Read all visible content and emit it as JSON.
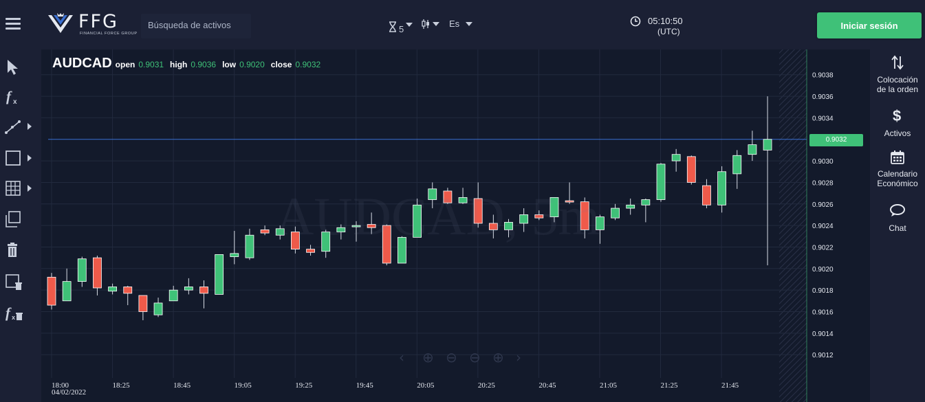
{
  "header": {
    "logo_text": "FFG",
    "logo_subtext": "FINANCIAL FORCE GROUP",
    "search_placeholder": "Búsqueda de activos",
    "timeframe_value": "5",
    "language": "Es",
    "clock_time": "05:10:50",
    "clock_zone": "(UTC)",
    "login_label": "Iniciar sesión",
    "login_color": "#3fc178"
  },
  "left_toolbar": {
    "tools": [
      {
        "name": "cursor-tool",
        "icon": "cursor-icon",
        "has_submenu": false
      },
      {
        "name": "indicator-tool",
        "icon": "function-icon",
        "has_submenu": false
      },
      {
        "name": "trendline-tool",
        "icon": "trendline-icon",
        "has_submenu": true
      },
      {
        "name": "rectangle-tool",
        "icon": "rectangle-icon",
        "has_submenu": true
      },
      {
        "name": "grid-tool",
        "icon": "grid-icon",
        "has_submenu": true
      },
      {
        "name": "clone-tool",
        "icon": "clone-icon",
        "has_submenu": false
      },
      {
        "name": "delete-tool",
        "icon": "trash-icon",
        "has_submenu": false
      },
      {
        "name": "delete-drawings-tool",
        "icon": "delete-drawings-icon",
        "has_submenu": false
      },
      {
        "name": "delete-indicators-tool",
        "icon": "delete-indicators-icon",
        "has_submenu": false
      }
    ]
  },
  "chart": {
    "symbol": "AUDCAD",
    "open_label": "open",
    "open_value": "0.9031",
    "high_label": "high",
    "high_value": "0.9036",
    "low_label": "low",
    "low_value": "0.9020",
    "close_label": "close",
    "close_value": "0.9032",
    "watermark": "AUDCAD, 5m",
    "current_price": "0.9032",
    "date_label": "04/02/2022"
  },
  "chart_data": {
    "type": "candlestick",
    "symbol": "AUDCAD",
    "timeframe": "5m",
    "up_color": "#3fc178",
    "down_color": "#ef5a4a",
    "ylim": [
      0.901,
      0.904
    ],
    "y_ticks": [
      "0.9038",
      "0.9036",
      "0.9034",
      "0.9030",
      "0.9028",
      "0.9026",
      "0.9024",
      "0.9022",
      "0.9020",
      "0.9018",
      "0.9016",
      "0.9014",
      "0.9012"
    ],
    "x_ticks": [
      "18:00",
      "18:25",
      "18:45",
      "19:05",
      "19:25",
      "19:45",
      "20:05",
      "20:25",
      "20:45",
      "21:05",
      "21:25",
      "21:45"
    ],
    "current_price": 0.9032,
    "candles": [
      {
        "t": "18:00",
        "o": 0.90192,
        "h": 0.90196,
        "l": 0.90162,
        "c": 0.90166
      },
      {
        "t": "18:05",
        "o": 0.9017,
        "h": 0.902,
        "l": 0.9017,
        "c": 0.90188
      },
      {
        "t": "18:10",
        "o": 0.90188,
        "h": 0.90211,
        "l": 0.90183,
        "c": 0.90209
      },
      {
        "t": "18:15",
        "o": 0.9021,
        "h": 0.90212,
        "l": 0.90175,
        "c": 0.90182
      },
      {
        "t": "18:20",
        "o": 0.90179,
        "h": 0.90186,
        "l": 0.90176,
        "c": 0.90183
      },
      {
        "t": "18:25",
        "o": 0.90183,
        "h": 0.90184,
        "l": 0.90166,
        "c": 0.90177
      },
      {
        "t": "18:30",
        "o": 0.90175,
        "h": 0.90175,
        "l": 0.90152,
        "c": 0.9016
      },
      {
        "t": "18:35",
        "o": 0.90157,
        "h": 0.90173,
        "l": 0.90155,
        "c": 0.90168
      },
      {
        "t": "18:40",
        "o": 0.9017,
        "h": 0.90184,
        "l": 0.9017,
        "c": 0.9018
      },
      {
        "t": "18:45",
        "o": 0.9018,
        "h": 0.90191,
        "l": 0.90176,
        "c": 0.90183
      },
      {
        "t": "18:50",
        "o": 0.90183,
        "h": 0.90189,
        "l": 0.90163,
        "c": 0.90177
      },
      {
        "t": "18:55",
        "o": 0.90176,
        "h": 0.90213,
        "l": 0.90176,
        "c": 0.90213
      },
      {
        "t": "19:00",
        "o": 0.90211,
        "h": 0.90235,
        "l": 0.90204,
        "c": 0.90214
      },
      {
        "t": "19:05",
        "o": 0.9021,
        "h": 0.90237,
        "l": 0.90208,
        "c": 0.90231
      },
      {
        "t": "19:10",
        "o": 0.90236,
        "h": 0.9024,
        "l": 0.90231,
        "c": 0.90233
      },
      {
        "t": "19:15",
        "o": 0.90231,
        "h": 0.9024,
        "l": 0.90227,
        "c": 0.90237
      },
      {
        "t": "19:20",
        "o": 0.90234,
        "h": 0.90239,
        "l": 0.90214,
        "c": 0.90218
      },
      {
        "t": "19:25",
        "o": 0.90218,
        "h": 0.90222,
        "l": 0.90212,
        "c": 0.90215
      },
      {
        "t": "19:30",
        "o": 0.90216,
        "h": 0.90236,
        "l": 0.9021,
        "c": 0.90234
      },
      {
        "t": "19:35",
        "o": 0.90234,
        "h": 0.90241,
        "l": 0.90227,
        "c": 0.90238
      },
      {
        "t": "19:40",
        "o": 0.90239,
        "h": 0.90244,
        "l": 0.90225,
        "c": 0.9024
      },
      {
        "t": "19:45",
        "o": 0.90241,
        "h": 0.90252,
        "l": 0.90232,
        "c": 0.90238
      },
      {
        "t": "19:50",
        "o": 0.9024,
        "h": 0.90241,
        "l": 0.90203,
        "c": 0.90205
      },
      {
        "t": "19:55",
        "o": 0.90205,
        "h": 0.9023,
        "l": 0.90205,
        "c": 0.90229
      },
      {
        "t": "20:05",
        "o": 0.90229,
        "h": 0.90265,
        "l": 0.90229,
        "c": 0.90259
      },
      {
        "t": "20:10",
        "o": 0.90264,
        "h": 0.9028,
        "l": 0.90256,
        "c": 0.90274
      },
      {
        "t": "20:15",
        "o": 0.90272,
        "h": 0.90275,
        "l": 0.9026,
        "c": 0.90261
      },
      {
        "t": "20:20",
        "o": 0.90261,
        "h": 0.90275,
        "l": 0.9026,
        "c": 0.90266
      },
      {
        "t": "20:25",
        "o": 0.90265,
        "h": 0.9028,
        "l": 0.90238,
        "c": 0.90242
      },
      {
        "t": "20:30",
        "o": 0.90242,
        "h": 0.9025,
        "l": 0.90228,
        "c": 0.90236
      },
      {
        "t": "20:35",
        "o": 0.90236,
        "h": 0.90246,
        "l": 0.90229,
        "c": 0.90243
      },
      {
        "t": "20:40",
        "o": 0.90242,
        "h": 0.90256,
        "l": 0.90234,
        "c": 0.9025
      },
      {
        "t": "20:45",
        "o": 0.9025,
        "h": 0.90254,
        "l": 0.90245,
        "c": 0.90247
      },
      {
        "t": "20:50",
        "o": 0.90248,
        "h": 0.90266,
        "l": 0.90243,
        "c": 0.90266
      },
      {
        "t": "20:55",
        "o": 0.90263,
        "h": 0.9028,
        "l": 0.9026,
        "c": 0.90262
      },
      {
        "t": "21:00",
        "o": 0.90262,
        "h": 0.90266,
        "l": 0.90228,
        "c": 0.90236
      },
      {
        "t": "21:05",
        "o": 0.90236,
        "h": 0.9025,
        "l": 0.90223,
        "c": 0.90248
      },
      {
        "t": "21:10",
        "o": 0.90247,
        "h": 0.9026,
        "l": 0.90245,
        "c": 0.90256
      },
      {
        "t": "21:15",
        "o": 0.90256,
        "h": 0.90265,
        "l": 0.9025,
        "c": 0.90259
      },
      {
        "t": "21:20",
        "o": 0.90259,
        "h": 0.90265,
        "l": 0.90243,
        "c": 0.90264
      },
      {
        "t": "21:25",
        "o": 0.90264,
        "h": 0.90298,
        "l": 0.90262,
        "c": 0.90297
      },
      {
        "t": "21:30",
        "o": 0.903,
        "h": 0.90311,
        "l": 0.9029,
        "c": 0.90306
      },
      {
        "t": "21:35",
        "o": 0.90304,
        "h": 0.90305,
        "l": 0.90278,
        "c": 0.9028
      },
      {
        "t": "21:40",
        "o": 0.90277,
        "h": 0.90283,
        "l": 0.90256,
        "c": 0.90259
      },
      {
        "t": "21:45",
        "o": 0.90259,
        "h": 0.90295,
        "l": 0.90252,
        "c": 0.9029
      },
      {
        "t": "21:50",
        "o": 0.90288,
        "h": 0.9031,
        "l": 0.90274,
        "c": 0.90305
      },
      {
        "t": "21:55",
        "o": 0.90306,
        "h": 0.90328,
        "l": 0.903,
        "c": 0.90315
      },
      {
        "t": "22:00",
        "o": 0.9031,
        "h": 0.9036,
        "l": 0.90203,
        "c": 0.9032
      }
    ]
  },
  "right_panel": {
    "items": [
      {
        "label1": "Colocación",
        "label2": "de la orden",
        "icon": "order-placement-icon"
      },
      {
        "label1": "Activos",
        "label2": "",
        "icon": "dollar-icon"
      },
      {
        "label1": "Calendario",
        "label2": "Económico",
        "icon": "calendar-icon"
      },
      {
        "label1": "Chat",
        "label2": "",
        "icon": "chat-icon"
      }
    ]
  }
}
